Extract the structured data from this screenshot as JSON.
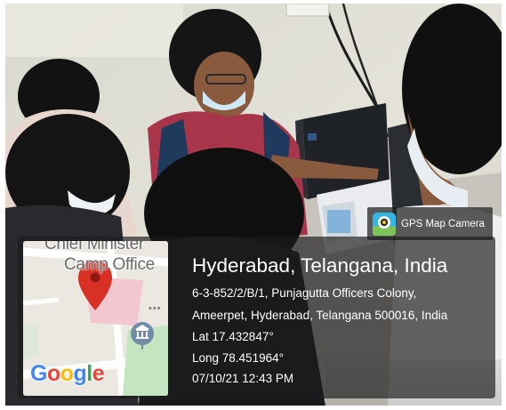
{
  "badge": {
    "label": "GPS Map Camera",
    "icon": "gps-map-camera-icon"
  },
  "location": {
    "city": "Hyderabad, Telangana, India",
    "address_line_1": "6-3-852/2/B/1, Punjagutta Officers Colony,",
    "address_line_2": "Ameerpet, Hyderabad, Telangana 500016, India",
    "latitude": "Lat 17.432847°",
    "longitude": "Long 78.451964°",
    "datetime": "07/10/21 12:43 PM"
  },
  "map": {
    "label_line_1": "Chief Minister",
    "label_line_2": "Camp Office",
    "brand": [
      "G",
      "o",
      "o",
      "g",
      "l",
      "e"
    ],
    "brand_colors": [
      "#4285F4",
      "#EA4335",
      "#FBBC05",
      "#4285F4",
      "#34A853",
      "#EA4335"
    ],
    "pin_color": "#D93025",
    "landmark_icon": "museum-icon"
  }
}
